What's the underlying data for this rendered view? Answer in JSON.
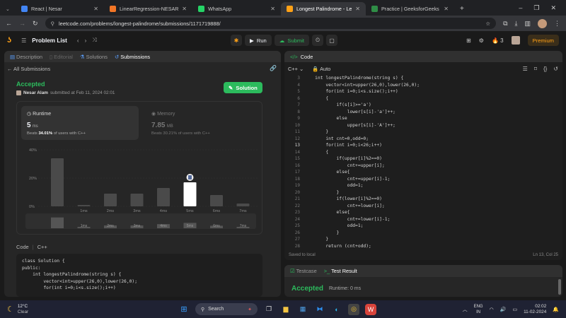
{
  "browser": {
    "tabs": [
      {
        "title": "React | Nesar",
        "color": "#4285f4"
      },
      {
        "title": "LinearRegression-NESAR.ipynb",
        "color": "#f37626"
      },
      {
        "title": "WhatsApp",
        "color": "#25d366"
      },
      {
        "title": "Longest Palindrome - LeetCode",
        "color": "#ffa116"
      },
      {
        "title": "Practice | GeeksforGeeks | A co",
        "color": "#2f8d46"
      }
    ],
    "new_tab": "+",
    "url": "leetcode.com/problems/longest-palindrome/submissions/1171719888/"
  },
  "leetcode": {
    "problem_list": "Problem List",
    "run": "Run",
    "submit": "Submit",
    "streak": "3",
    "premium": "Premium",
    "left_tabs": [
      "Description",
      "Editorial",
      "Solutions",
      "Submissions"
    ],
    "all_submissions": "All Submissions",
    "status": "Accepted",
    "author": "Nesar Alam",
    "submitted": "submitted at Feb 11, 2024 02:01",
    "solution_btn": "Solution",
    "runtime_label": "Runtime",
    "runtime_value": "5",
    "runtime_unit": "ms",
    "runtime_beats_pre": "Beats",
    "runtime_beats": "34.01%",
    "runtime_beats_post": "of users with C++",
    "memory_label": "Memory",
    "memory_value": "7.85",
    "memory_unit": "MB",
    "memory_beats": "Beats 30.21% of users with C++",
    "code_label": "Code",
    "code_lang": "C++"
  },
  "chart_data": {
    "type": "bar",
    "y_ticks": [
      "40%",
      "20%",
      "0%"
    ],
    "ylim": [
      0,
      40
    ],
    "bars": [
      {
        "x": "",
        "value": 34,
        "highlight": false
      },
      {
        "x": "1ms",
        "value": 1,
        "highlight": false
      },
      {
        "x": "2ms",
        "value": 9,
        "highlight": false
      },
      {
        "x": "3ms",
        "value": 9,
        "highlight": false
      },
      {
        "x": "4ms",
        "value": 13,
        "highlight": false
      },
      {
        "x": "5ms",
        "value": 17,
        "highlight": true
      },
      {
        "x": "6ms",
        "value": 8,
        "highlight": false
      },
      {
        "x": "7ms",
        "value": 2,
        "highlight": false
      }
    ],
    "mini_labels": [
      "1ms",
      "2ms",
      "3ms",
      "4ms",
      "5ms",
      "6ms",
      "7ms"
    ]
  },
  "code_preview": [
    "class Solution {",
    "public:",
    "    int longestPalindrome(string s) {",
    "        vector<int>upper(26,0),lower(26,0);",
    "        for(int i=0;i<s.size();i++)"
  ],
  "editor": {
    "title": "Code",
    "lang": "C++",
    "mode": "Auto",
    "first_line": 3,
    "current_line": 13,
    "lines": [
      "    int longestPalindrome(string s) {",
      "        vector<int>upper(26,0),lower(26,0);",
      "        for(int i=0;i<s.size();i++)",
      "        {",
      "            if(s[i]>='a')",
      "                lower[s[i]-'a']++;",
      "            else",
      "                upper[s[i]-'A']++;",
      "        }",
      "        int cnt=0,odd=0;",
      "        for(int i=0;i<26;i++)",
      "        {",
      "            if(upper[i]%2==0)",
      "                cnt+=upper[i];",
      "            else{",
      "                cnt+=upper[i]-1;",
      "                odd=1;",
      "            }",
      "            if(lower[i]%2==0)",
      "                cnt+=lower[i];",
      "            else{",
      "                cnt+=lower[i]-1;",
      "                odd=1;",
      "            }",
      "        }",
      "        return (cnt+odd);"
    ],
    "saved": "Saved to local",
    "position": "Ln 13, Col 25"
  },
  "testpanel": {
    "tab1": "Testcase",
    "tab2": "Test Result",
    "status": "Accepted",
    "runtime": "Runtime: 0 ms"
  },
  "taskbar": {
    "temp": "12°C",
    "weather": "Clear",
    "search": "Search",
    "lang1": "ENG",
    "lang2": "IN",
    "time": "02:02",
    "date": "11-02-2024"
  }
}
